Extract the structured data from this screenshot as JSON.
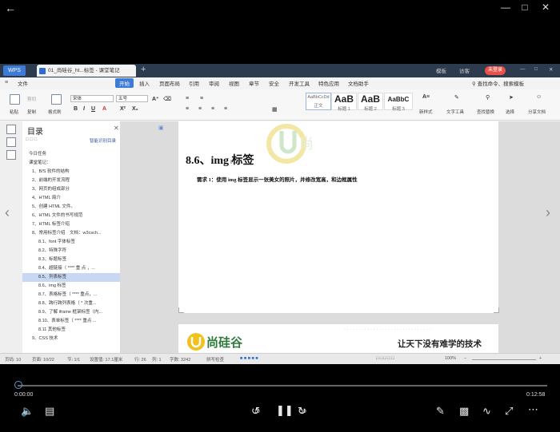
{
  "player": {
    "time_current": "0:00:00",
    "time_total": "0:12:58",
    "progress": 0.0,
    "skip_back": "10",
    "skip_forward": "30"
  },
  "wps": {
    "app_tab": "WPS",
    "doc_tab": "01_尚硅谷_ht...标签 - 课堂笔记",
    "top_right": [
      "模板",
      "访客",
      "未登录"
    ],
    "menu": [
      "文件",
      "开始",
      "插入",
      "页面布局",
      "引用",
      "审阅",
      "视图",
      "章节",
      "安全",
      "开发工具",
      "特色应用",
      "文档助手"
    ],
    "active_menu": "开始",
    "search_hint": "查找命令、搜索模板",
    "ribbon": {
      "paste": "粘贴",
      "cut": "剪切",
      "copy": "复制",
      "format_painter": "格式刷",
      "font_name": "宋体",
      "font_size": "五号",
      "styles": [
        {
          "sample": "AaBbCcDd",
          "name": "正文"
        },
        {
          "sample": "AaB",
          "name": "标题 1"
        },
        {
          "sample": "AaB",
          "name": "标题 2"
        },
        {
          "sample": "AaBbC",
          "name": "标题 3"
        }
      ],
      "new_style": "新样式",
      "text_tools": "文字工具",
      "find_replace": "查找替换",
      "select": "选择",
      "share": "分享文档"
    }
  },
  "toc": {
    "title": "目录",
    "smart": "智能识别目录",
    "items": [
      "今日任务",
      "课堂笔记：",
      "1、B/S 软件的结构",
      "2、前端的开发流程",
      "3、网页的组成部分",
      "4、HTML 简介",
      "5、创建 HTML 文件。",
      "6、HTML 文件的书写规范",
      "7、HTML 标签介绍",
      "8、常用标签介绍　文档：w3csch...",
      "8.1、font 字体标签",
      "8.2、特殊字符",
      "8.3、标题标签",
      "8.4、超链接（ **** 重 点 ，...",
      "8.5、列表标签",
      "8.6、img 标签",
      "8.7、表格标签（ **** 重点，...",
      "8.8、跨行跨列表格（ * 次重...",
      "8.9、了解 iframe 框架标签（内...",
      "8.10、表单标签（ **** 重点 ...",
      "8.11 其他标签",
      "9、CSS 技术"
    ],
    "selected_index": 14
  },
  "document": {
    "heading": "8.6、img 标签",
    "requirement": "需求 1：使用 img 标签显示一张美女的照片，并修改宽高，和边框属性",
    "logo_text": "尚硅谷",
    "slogan": "让天下没有难学的技术"
  },
  "status": {
    "page": "页码: 10",
    "pages": "页面: 10/22",
    "section": "节: 1/1",
    "position": "设置值: 17.1厘米",
    "row": "行: 26",
    "col": "列: 1",
    "words": "字数: 3242",
    "spell": "拼写检查",
    "zoom": "100%"
  }
}
